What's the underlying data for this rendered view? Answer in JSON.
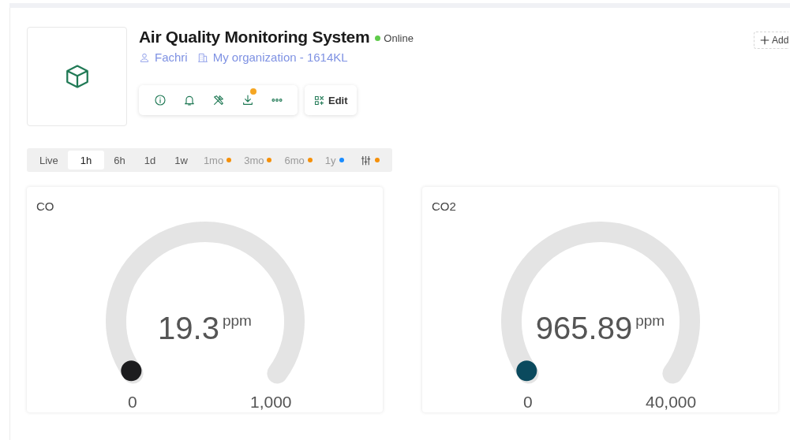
{
  "device": {
    "title": "Air Quality Monitoring System",
    "status": {
      "label": "Online",
      "online": true
    },
    "owner": "Fachri",
    "organization": "My organization - 1614KL"
  },
  "toolbar": [
    {
      "kind": "info",
      "badge": false
    },
    {
      "kind": "bell",
      "badge": false
    },
    {
      "kind": "tools",
      "badge": false
    },
    {
      "kind": "download",
      "badge": true
    },
    {
      "kind": "more",
      "badge": false
    }
  ],
  "edit_button": "Edit",
  "add_button": "Add",
  "time_ranges": [
    {
      "label": "Live",
      "selected": false,
      "dim": false
    },
    {
      "label": "1h",
      "selected": true,
      "dim": false
    },
    {
      "label": "6h",
      "selected": false,
      "dim": false
    },
    {
      "label": "1d",
      "selected": false,
      "dim": false
    },
    {
      "label": "1w",
      "selected": false,
      "dim": false
    },
    {
      "label": "1mo",
      "selected": false,
      "dim": true,
      "color": "#f5900a"
    },
    {
      "label": "3mo",
      "selected": false,
      "dim": true,
      "color": "#f5900a"
    },
    {
      "label": "6mo",
      "selected": false,
      "dim": true,
      "color": "#f5900a"
    },
    {
      "label": "1y",
      "selected": false,
      "dim": true,
      "color": "#1a8cff"
    },
    {
      "kind": "filter",
      "selected": false,
      "dim": false,
      "color": "#f5900a"
    }
  ],
  "gauges": [
    {
      "title": "CO",
      "value": "19.3",
      "unit": "ppm",
      "min": "0",
      "max": "1,000",
      "color": "#1c1c1e"
    },
    {
      "title": "CO2",
      "value": "965.89",
      "unit": "ppm",
      "min": "0",
      "max": "40,000",
      "color": "#0b4a5e"
    }
  ]
}
